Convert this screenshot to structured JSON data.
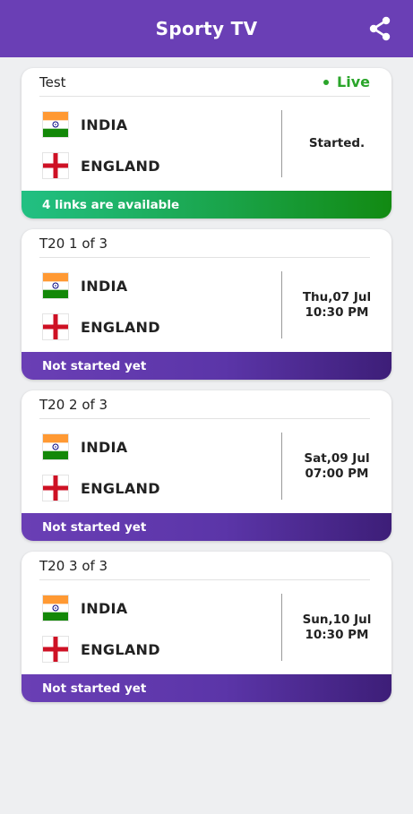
{
  "app": {
    "title": "Sporty TV",
    "share_icon": "share-icon",
    "colors": {
      "primary": "#6a3fb5",
      "live": "#2aa52a",
      "available": "#1aa44a"
    }
  },
  "matches": [
    {
      "type": "Test",
      "live_label": "Live",
      "team1": {
        "name": "INDIA",
        "flag": "india-flag-icon"
      },
      "team2": {
        "name": "ENGLAND",
        "flag": "england-flag-icon"
      },
      "status_line1": "Started.",
      "status_line2": "",
      "footer": "4 links are available"
    },
    {
      "type": "T20 1 of 3",
      "team1": {
        "name": "INDIA",
        "flag": "india-flag-icon"
      },
      "team2": {
        "name": "ENGLAND",
        "flag": "england-flag-icon"
      },
      "status_line1": "Thu,07 Jul",
      "status_line2": "10:30 PM",
      "footer": "Not started yet"
    },
    {
      "type": "T20 2 of 3",
      "team1": {
        "name": "INDIA",
        "flag": "india-flag-icon"
      },
      "team2": {
        "name": "ENGLAND",
        "flag": "england-flag-icon"
      },
      "status_line1": "Sat,09 Jul",
      "status_line2": "07:00 PM",
      "footer": "Not started yet"
    },
    {
      "type": "T20 3 of 3",
      "team1": {
        "name": "INDIA",
        "flag": "india-flag-icon"
      },
      "team2": {
        "name": "ENGLAND",
        "flag": "england-flag-icon"
      },
      "status_line1": "Sun,10 Jul",
      "status_line2": "10:30 PM",
      "footer": "Not started yet"
    }
  ]
}
